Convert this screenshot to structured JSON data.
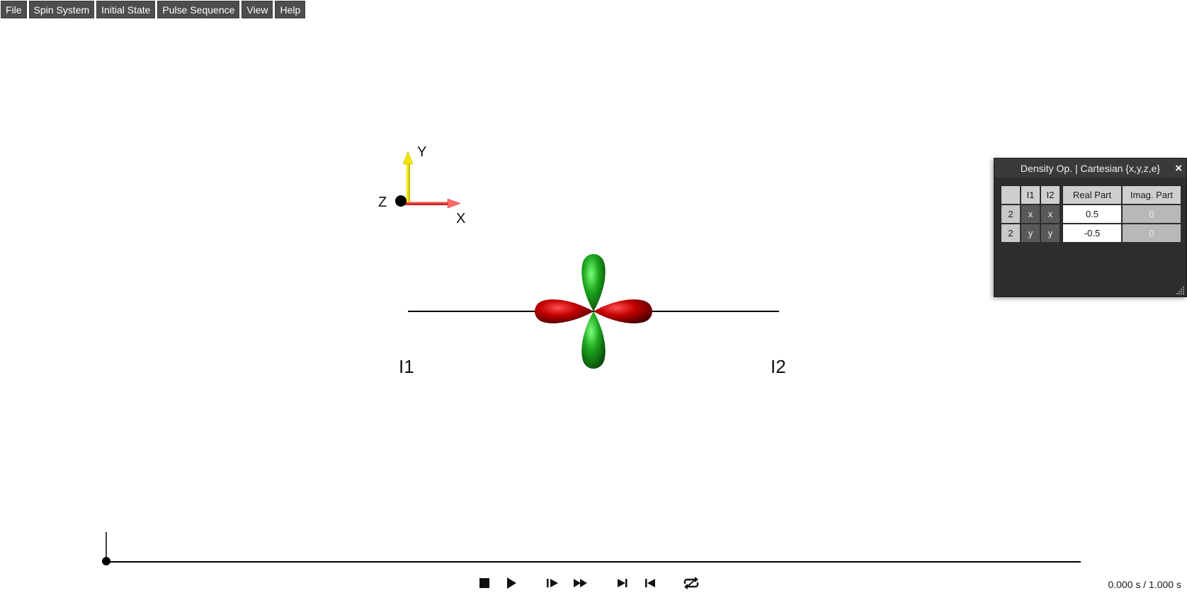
{
  "menu": {
    "items": [
      {
        "label": "File"
      },
      {
        "label": "Spin System"
      },
      {
        "label": "Initial State"
      },
      {
        "label": "Pulse Sequence"
      },
      {
        "label": "View"
      },
      {
        "label": "Help"
      }
    ]
  },
  "axes": {
    "x_label": "X",
    "y_label": "Y",
    "z_label": "Z",
    "x_color": "#e53935",
    "y_color": "#f2e600",
    "z_color": "#000000"
  },
  "spins": {
    "left_label": "I1",
    "right_label": "I2",
    "lobe_red": "#b00000",
    "lobe_green": "#1fa81f"
  },
  "density_panel": {
    "title": "Density Op. | Cartesian {x,y,z,e}",
    "close_icon": "×",
    "headers": {
      "blank": "",
      "i1": "I1",
      "i2": "I2",
      "real": "Real Part",
      "imag": "Imag. Part"
    },
    "rows": [
      {
        "idx": "2",
        "i1": "x",
        "i2": "x",
        "real": "0.5",
        "imag": "0"
      },
      {
        "idx": "2",
        "i1": "y",
        "i2": "y",
        "real": "-0.5",
        "imag": "0"
      }
    ]
  },
  "timeline": {
    "position": 0.0
  },
  "controls": {
    "stop": "stop-icon",
    "play": "play-icon",
    "step_forward": "step-forward-icon",
    "fast_forward": "fast-forward-icon",
    "skip_end": "skip-to-end-icon",
    "skip_start": "skip-to-start-icon",
    "loop": "loop-icon"
  },
  "time_readout": "0.000 s / 1.000 s"
}
